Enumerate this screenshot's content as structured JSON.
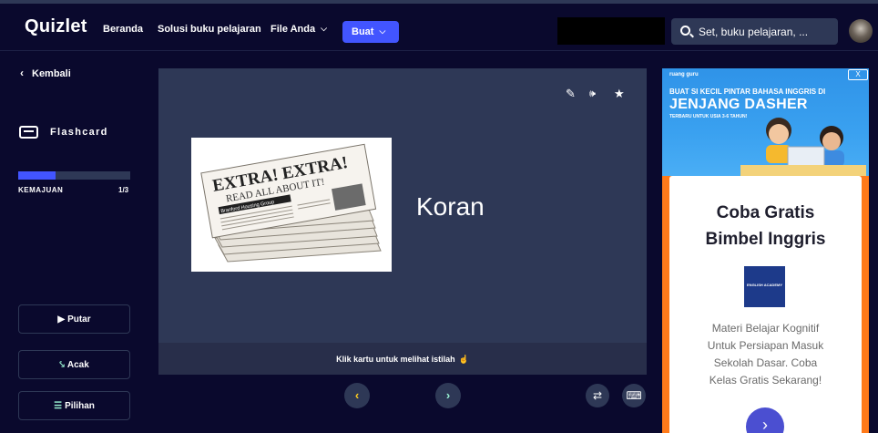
{
  "header": {
    "logo": "Quizlet",
    "nav": [
      "Beranda",
      "Solusi buku pelajaran",
      "File Anda"
    ],
    "create_label": "Buat",
    "search_placeholder": "Set, buku pelajaran, ..."
  },
  "sidebar": {
    "back_label": "Kembali",
    "mode_label": "Flashcard",
    "progress_label": "KEMAJUAN",
    "progress_count": "1/3",
    "progress_fraction": 0.33,
    "play_label": "Putar",
    "shuffle_label": "Acak",
    "options_label": "Pilihan"
  },
  "card": {
    "term": "Koran",
    "image": {
      "headline1": "EXTRA! EXTRA!",
      "headline2": "READ ALL ABOUT IT!",
      "banner": "Branford Housing Group"
    },
    "footer_text": "Klik kartu untuk melihat istilah",
    "tools": [
      "edit-icon",
      "audio-icon",
      "star-icon"
    ]
  },
  "controls": {
    "prev": "‹",
    "next": "›"
  },
  "ad": {
    "brand": "ruang guru",
    "close": "X",
    "line1": "BUAT SI KECIL PINTAR BAHASA INGGRIS DI",
    "line2": "JENJANG DASHER",
    "line3": "TERBARU UNTUK USIA 3-6 TAHUN!",
    "headline_line1": "Coba Gratis",
    "headline_line2": "Bimbel Inggris",
    "logo_text": "ENGLISH ACADEMY",
    "body_line1": "Materi Belajar Kognitif",
    "body_line2": "Untuk Persiapan Masuk",
    "body_line3": "Sekolah Dasar. Coba",
    "body_line4": "Kelas Gratis Sekarang!"
  },
  "colors": {
    "background": "#0a092d",
    "card": "#2e3856",
    "accent": "#4255ff",
    "ad_orange": "#ff7a1a"
  }
}
